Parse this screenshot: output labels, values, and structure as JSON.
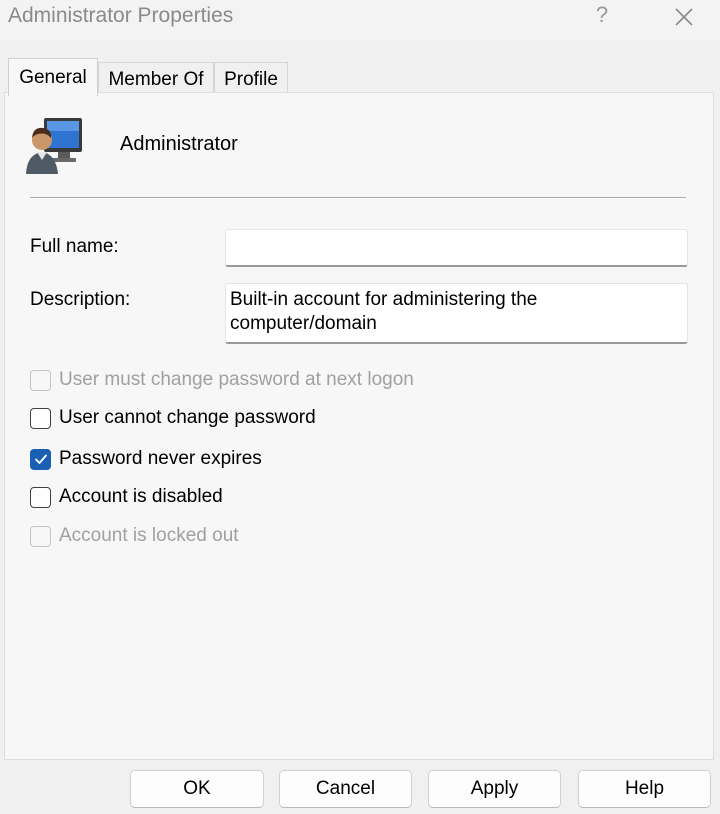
{
  "window": {
    "title": "Administrator Properties",
    "help_glyph": "?",
    "close_icon": "close-icon"
  },
  "tabs": [
    {
      "label": "General",
      "active": true
    },
    {
      "label": "Member Of",
      "active": false
    },
    {
      "label": "Profile",
      "active": false
    }
  ],
  "general": {
    "user_icon": "user-account-icon",
    "user_name": "Administrator",
    "full_name": {
      "label": "Full name:",
      "value": ""
    },
    "description": {
      "label": "Description:",
      "value": "Built-in account for administering the computer/domain"
    },
    "checkboxes": [
      {
        "label": "User must change password at next logon",
        "checked": false,
        "enabled": false
      },
      {
        "label": "User cannot change password",
        "checked": false,
        "enabled": true
      },
      {
        "label": "Password never expires",
        "checked": true,
        "enabled": true
      },
      {
        "label": "Account is disabled",
        "checked": false,
        "enabled": true
      },
      {
        "label": "Account is locked out",
        "checked": false,
        "enabled": false
      }
    ]
  },
  "buttons": {
    "ok": "OK",
    "cancel": "Cancel",
    "apply": "Apply",
    "help": "Help"
  },
  "colors": {
    "accent": "#1a5fb4",
    "window_bg": "#f0f0f0",
    "panel_bg": "#f7f7f7",
    "disabled_text": "#a0a0a0"
  }
}
